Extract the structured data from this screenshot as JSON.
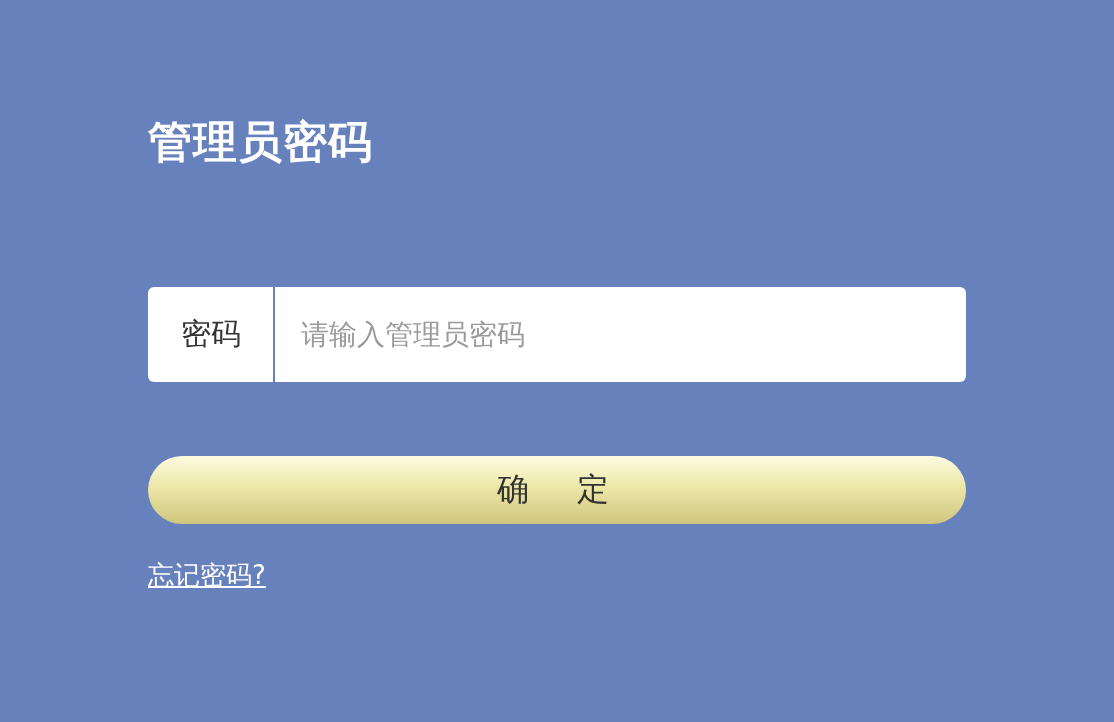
{
  "title": "管理员密码",
  "password_field": {
    "label": "密码",
    "placeholder": "请输入管理员密码"
  },
  "confirm_button": "确　定",
  "forgot_link": "忘记密码?"
}
